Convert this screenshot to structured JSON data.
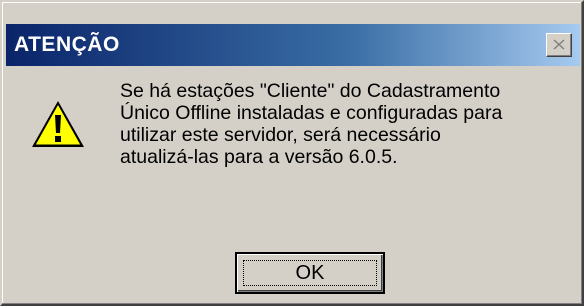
{
  "window": {
    "title": "ATENÇÃO",
    "close_icon": "close-icon"
  },
  "dialog": {
    "icon": "warning-icon",
    "message_lines": [
      "Se há estações \"Cliente\" do Cadastramento",
      "Único Offline instaladas e configuradas para",
      "utilizar este servidor, será necessário",
      "atualizá-las para a versão 6.0.5."
    ],
    "ok_label": "OK"
  },
  "colors": {
    "title_start": "#0a246a",
    "title_end": "#a6caf0",
    "face": "#d4d0c8",
    "warning_fill": "#ffff00"
  }
}
